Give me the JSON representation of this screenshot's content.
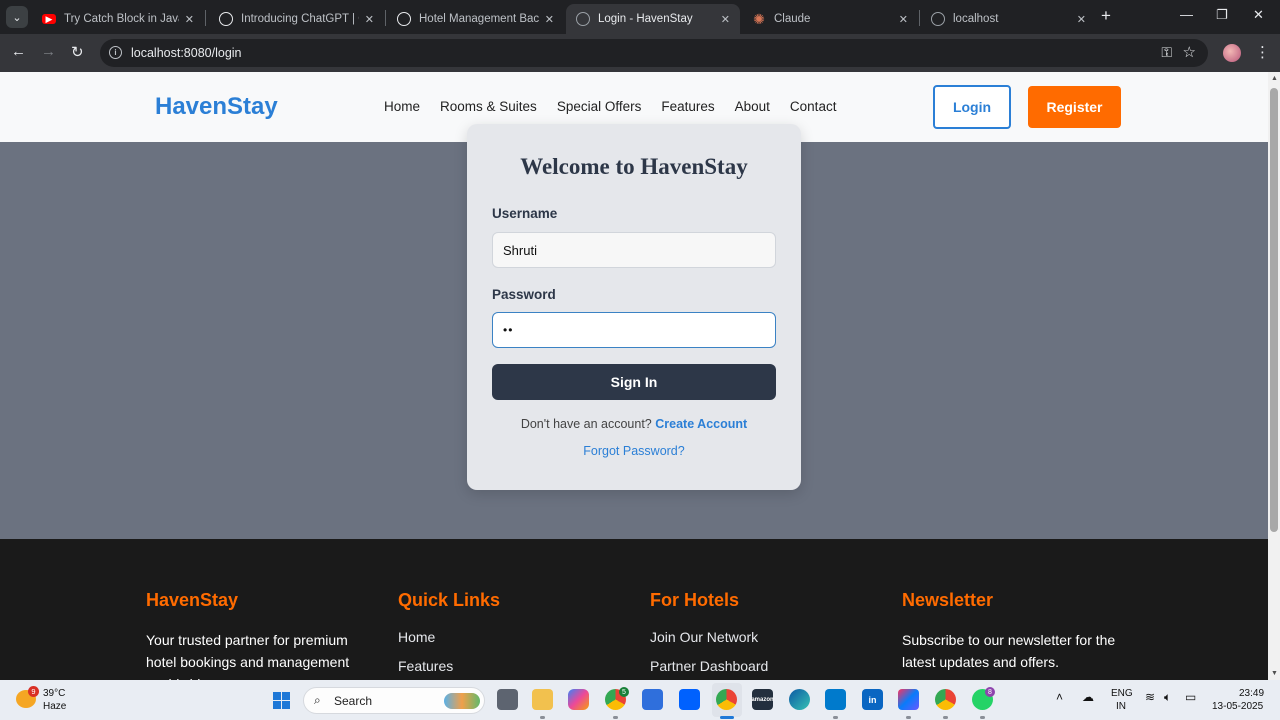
{
  "browser": {
    "tabs": [
      {
        "title": "Try Catch Block in Java - Yo",
        "favicon": "youtube-icon",
        "color": "#ff0000"
      },
      {
        "title": "Introducing ChatGPT | Ope",
        "favicon": "openai-icon",
        "color": "#e8eaed"
      },
      {
        "title": "Hotel Management Backen",
        "favicon": "openai-icon",
        "color": "#e8eaed"
      },
      {
        "title": "Login - HavenStay",
        "favicon": "globe-icon",
        "color": "#9aa0a6",
        "active": true
      },
      {
        "title": "Claude",
        "favicon": "claude-icon",
        "color": "#d97757"
      },
      {
        "title": "localhost",
        "favicon": "globe-icon",
        "color": "#9aa0a6"
      }
    ],
    "url": "localhost:8080/login"
  },
  "site": {
    "brand": "HavenStay",
    "nav": [
      "Home",
      "Rooms & Suites",
      "Special Offers",
      "Features",
      "About",
      "Contact"
    ],
    "login_label": "Login",
    "register_label": "Register",
    "colors": {
      "brand_blue": "#2b7fd6",
      "accent_orange": "#ff6b00",
      "dark": "#2d3748"
    }
  },
  "login": {
    "title": "Welcome to HavenStay",
    "username_label": "Username",
    "username_value": "Shruti",
    "password_label": "Password",
    "password_value": "••",
    "signin_label": "Sign In",
    "no_account_text": "Don't have an account?",
    "create_account_label": "Create Account",
    "forgot_label": "Forgot Password?"
  },
  "footer": {
    "col1": {
      "title": "HavenStay",
      "text": "Your trusted partner for premium hotel bookings and management worldwide."
    },
    "col2": {
      "title": "Quick Links",
      "links": [
        "Home",
        "Features"
      ]
    },
    "col3": {
      "title": "For Hotels",
      "links": [
        "Join Our Network",
        "Partner Dashboard"
      ]
    },
    "col4": {
      "title": "Newsletter",
      "text": "Subscribe to our newsletter for the latest updates and offers."
    }
  },
  "taskbar": {
    "temperature": "39°C",
    "weather": "Haze",
    "weather_badge": "9",
    "search_label": "Search",
    "lang_line1": "ENG",
    "lang_line2": "IN",
    "time": "23:49",
    "date": "13-05-2025",
    "whatsapp_badge": "8",
    "chrome_badge": "5"
  }
}
